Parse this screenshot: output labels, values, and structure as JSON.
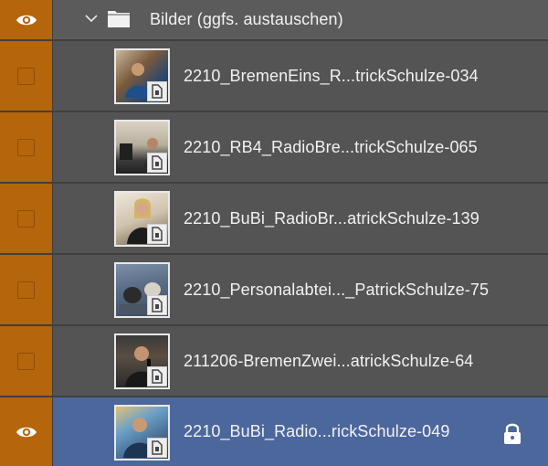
{
  "group": {
    "name": "Bilder (ggfs. austauschen)",
    "visible": true,
    "expanded": true,
    "visibility_icon": "eye-icon",
    "toggle_icon": "chevron-down-icon",
    "folder_icon": "folder-icon"
  },
  "layers": [
    {
      "name": "2210_BremenEins_R...trickSchulze-034",
      "visible": false,
      "selected": false,
      "locked": false
    },
    {
      "name": "2210_RB4_RadioBre...trickSchulze-065",
      "visible": false,
      "selected": false,
      "locked": false
    },
    {
      "name": "2210_BuBi_RadioBr...atrickSchulze-139",
      "visible": false,
      "selected": false,
      "locked": false
    },
    {
      "name": "2210_Personalabtei..._PatrickSchulze-75",
      "visible": false,
      "selected": false,
      "locked": false
    },
    {
      "name": "211206-BremenZwei...atrickSchulze-64",
      "visible": false,
      "selected": false,
      "locked": false
    },
    {
      "name": "2210_BuBi_Radio...rickSchulze-049",
      "visible": true,
      "selected": true,
      "locked": true
    }
  ],
  "colors": {
    "visibility_column": "#b5650a",
    "selection": "#4c679c",
    "row": "#545454"
  }
}
